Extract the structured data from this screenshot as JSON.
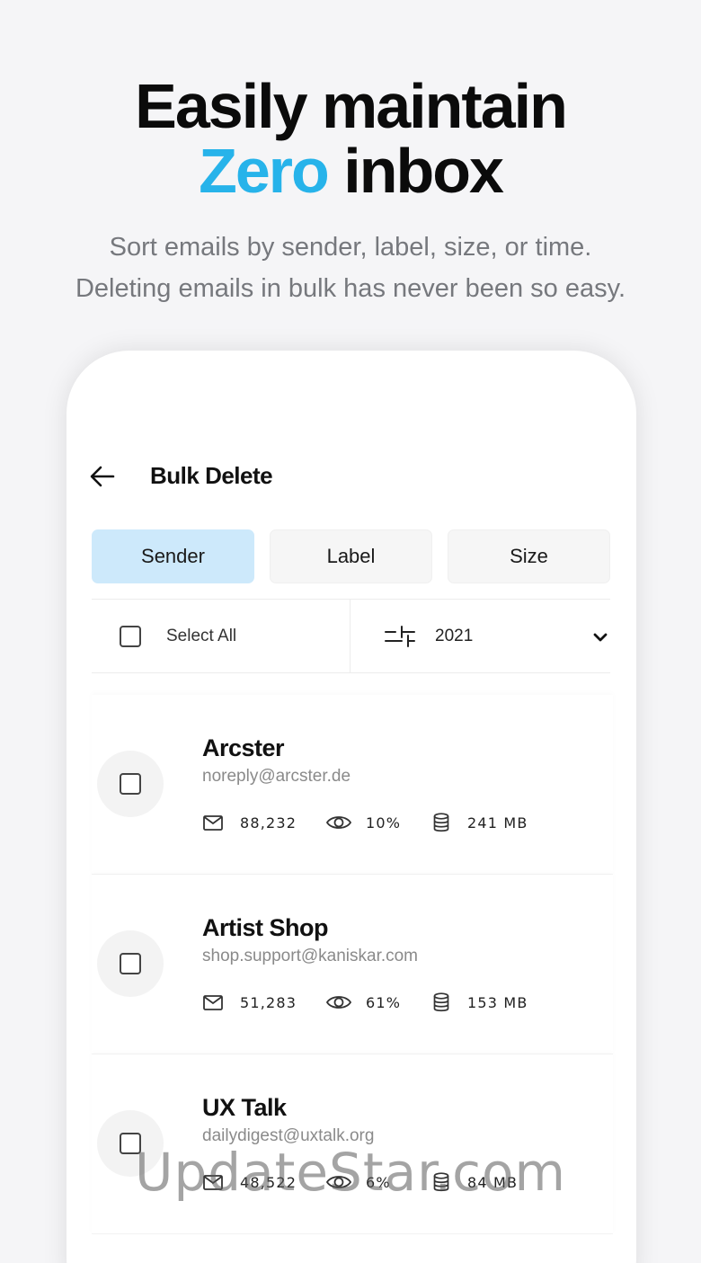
{
  "headline": {
    "line1": "Easily maintain",
    "accent": "Zero",
    "line2_rest": " inbox"
  },
  "subtitle": {
    "line1": "Sort emails by sender, label, size, or time.",
    "line2": "Deleting emails in bulk has never been so easy."
  },
  "screen": {
    "title": "Bulk Delete",
    "tabs": [
      {
        "label": "Sender",
        "active": true
      },
      {
        "label": "Label",
        "active": false
      },
      {
        "label": "Size",
        "active": false
      }
    ],
    "filter": {
      "select_all_label": "Select All",
      "year": "2021"
    },
    "senders": [
      {
        "name": "Arcster",
        "email": "noreply@arcster.de",
        "emails": "88,232",
        "read": "10%",
        "size": "241 MB"
      },
      {
        "name": "Artist Shop",
        "email": "shop.support@kaniskar.com",
        "emails": "51,283",
        "read": "61%",
        "size": "153 MB"
      },
      {
        "name": "UX Talk",
        "email": "dailydigest@uxtalk.org",
        "emails": "48,522",
        "read": "6%",
        "size": "84 MB"
      }
    ]
  },
  "watermark": "UpdateStar.com",
  "colors": {
    "accent": "#27b3ea",
    "active_tab": "#cde9fb",
    "background": "#f5f5f7"
  },
  "icons": {
    "back": "arrow-left-icon",
    "filter": "sliders-icon",
    "dropdown": "chevron-down-icon",
    "emails": "mail-icon",
    "read_rate": "eye-icon",
    "storage": "database-icon"
  }
}
